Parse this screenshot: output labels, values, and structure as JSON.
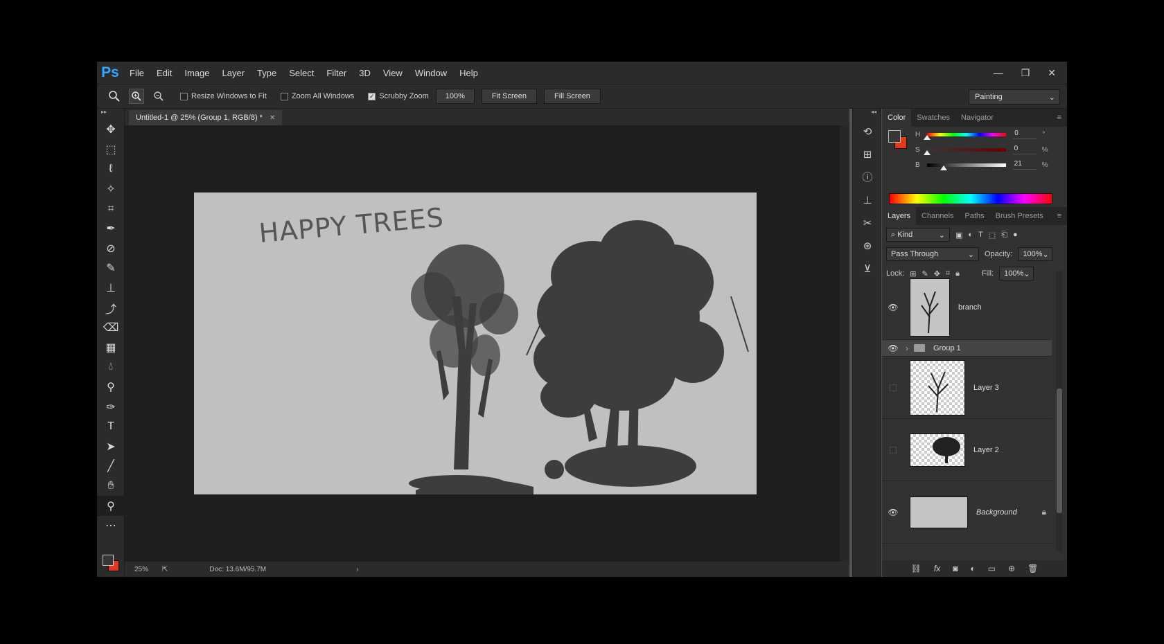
{
  "app": {
    "logo": "Ps"
  },
  "menu": [
    "File",
    "Edit",
    "Image",
    "Layer",
    "Type",
    "Select",
    "Filter",
    "3D",
    "View",
    "Window",
    "Help"
  ],
  "window_controls": {
    "minimize": "—",
    "restore": "❐",
    "close": "✕"
  },
  "options_bar": {
    "resize_windows": "Resize Windows to Fit",
    "zoom_all_windows": "Zoom All Windows",
    "scrubby_zoom": "Scrubby Zoom",
    "zoom_value": "100%",
    "fit_screen": "Fit Screen",
    "fill_screen": "Fill Screen",
    "workspace": "Painting"
  },
  "document": {
    "tab_title": "Untitled-1 @ 25% (Group 1, RGB/8) *",
    "tab_close": "✕",
    "canvas_text": "HAPPY TREES",
    "canvas_bg": "#c0c0c0",
    "tree_color": "#3d3d3d",
    "status_zoom": "25%",
    "status_doc": "Doc: 13.6M/95.7M"
  },
  "color_panel": {
    "tabs": [
      "Color",
      "Swatches",
      "Navigator"
    ],
    "sliders": [
      {
        "label": "H",
        "value": "0",
        "unit": "°",
        "level": 0.0
      },
      {
        "label": "S",
        "value": "0",
        "unit": "%",
        "level": 0.0
      },
      {
        "label": "B",
        "value": "21",
        "unit": "%",
        "level": 0.21
      }
    ],
    "foreground": "#363636",
    "background": "#e03a1e"
  },
  "layers_panel": {
    "tabs": [
      "Layers",
      "Channels",
      "Paths",
      "Brush Presets"
    ],
    "filter_kind": "Kind",
    "blend_mode": "Pass Through",
    "opacity_label": "Opacity:",
    "opacity": "100%",
    "lock_label": "Lock:",
    "fill_label": "Fill:",
    "fill": "100%",
    "layers": [
      {
        "name": "branch",
        "visible": true
      },
      {
        "name": "Group 1",
        "visible": true,
        "group": true
      },
      {
        "name": "Layer 3",
        "visible": false
      },
      {
        "name": "Layer 2",
        "visible": false
      },
      {
        "name": "Background",
        "visible": true
      }
    ]
  },
  "toolbar": {
    "tools": [
      "move-tool",
      "marquee-tool",
      "lasso-tool",
      "magic-wand-tool",
      "crop-tool",
      "eyedropper-tool",
      "healing-brush-tool",
      "brush-tool",
      "clone-stamp-tool",
      "history-brush-tool",
      "eraser-tool",
      "gradient-tool",
      "blur-tool",
      "dodge-tool",
      "pen-tool",
      "type-tool",
      "path-selection-tool",
      "line-tool",
      "hand-tool",
      "zoom-tool",
      "more-tools"
    ]
  }
}
